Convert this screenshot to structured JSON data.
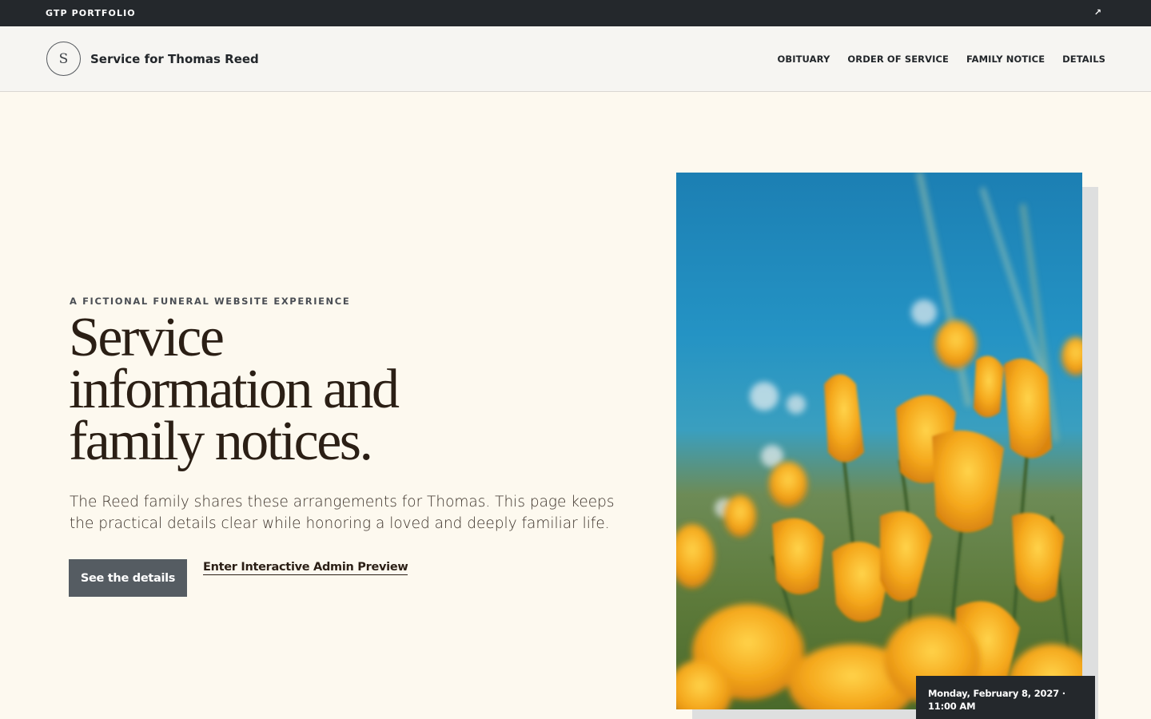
{
  "topbar": {
    "brand": "GTP PORTFOLIO",
    "external_icon": "external-link-icon",
    "external_glyph": "↗"
  },
  "header": {
    "monogram": "S",
    "title": "Service for Thomas Reed",
    "nav": [
      "OBITUARY",
      "ORDER OF SERVICE",
      "FAMILY NOTICE",
      "DETAILS"
    ]
  },
  "hero": {
    "eyebrow": "A FICTIONAL FUNERAL WEBSITE EXPERIENCE",
    "headline_lines": [
      "Service",
      "information and",
      "family notices."
    ],
    "lede_lines": [
      "The Reed family shares these arrangements for Thomas. This page keeps",
      "the practical details clear while honoring a loved and deeply familiar life."
    ],
    "primary_button": "See the details",
    "secondary_link": "Enter Interactive Admin Preview"
  },
  "photo": {
    "subject": "orange-poppies-photo"
  },
  "date_card": {
    "lines": [
      "Monday, February 8, 2027 ·",
      "11:00 AM"
    ]
  },
  "colors": {
    "topbar": "#24282c",
    "background": "#fdf9ef",
    "button": "#555c62",
    "text": "#2b1f15"
  }
}
